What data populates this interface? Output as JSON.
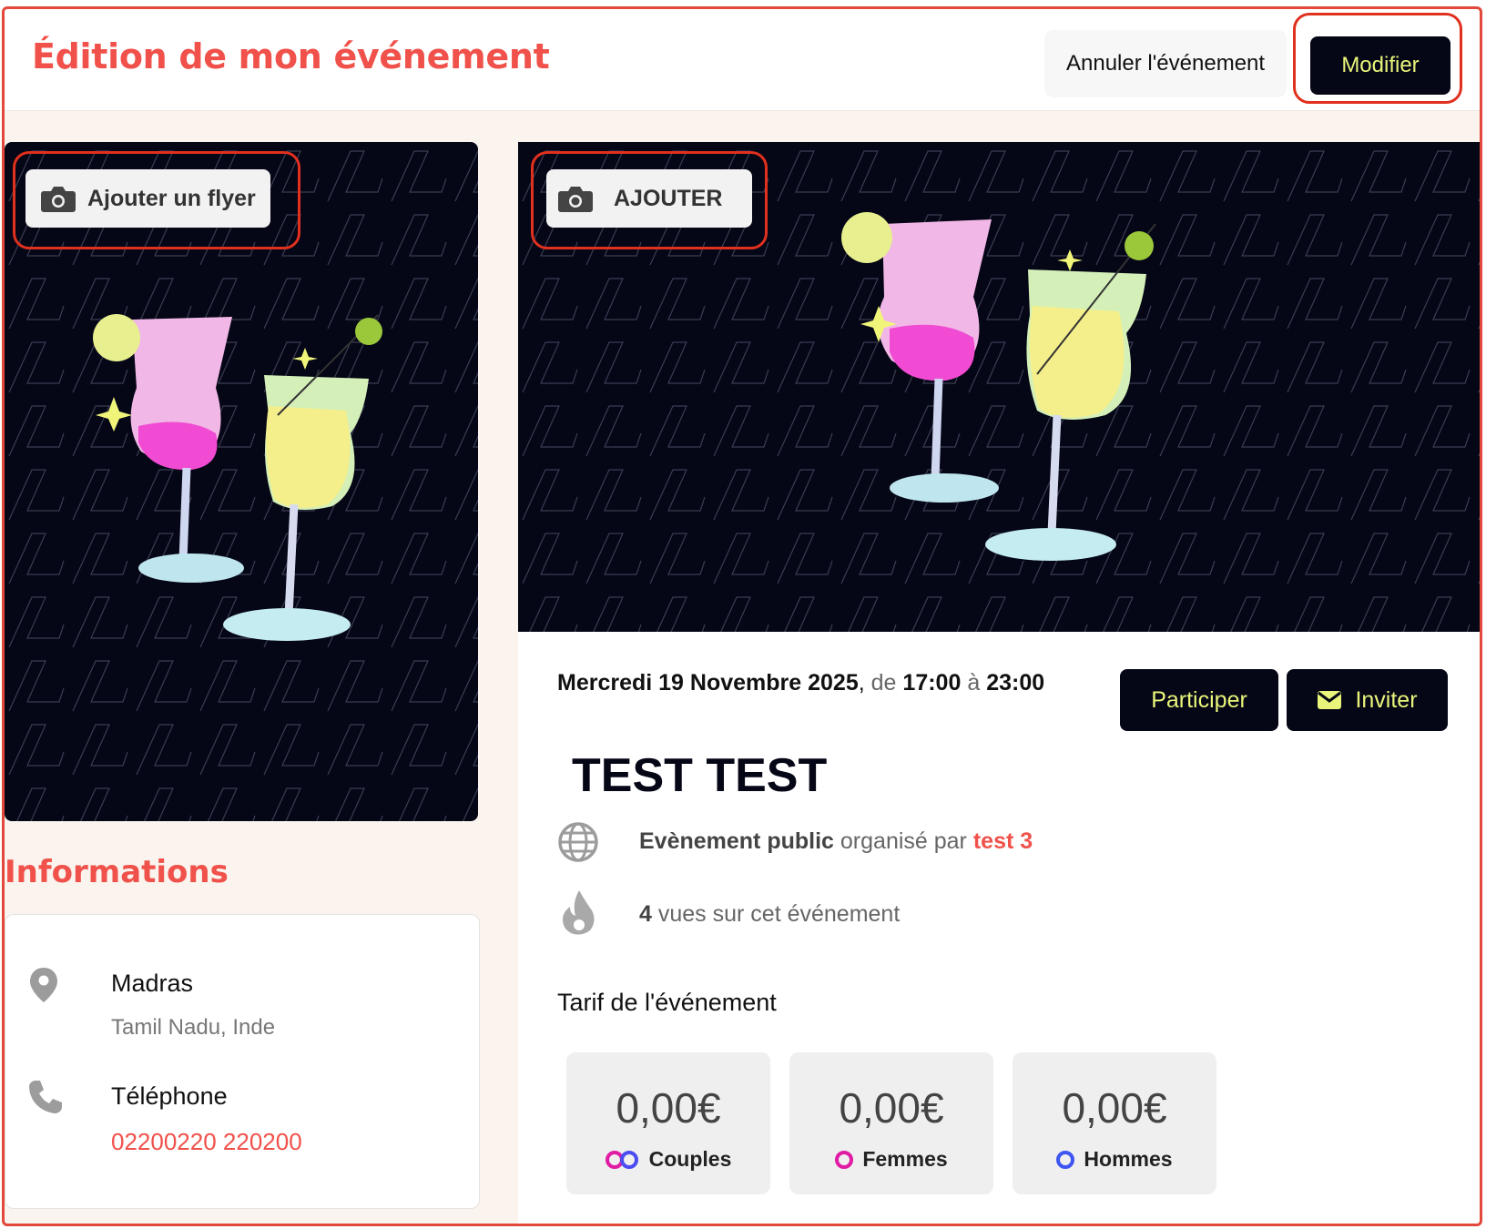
{
  "header": {
    "title": "Édition de mon événement",
    "cancel_label": "Annuler l'événement",
    "modify_label": "Modifier"
  },
  "flyer": {
    "add_label": "Ajouter un flyer",
    "camera_icon": "camera-icon"
  },
  "banner": {
    "add_label": "AJOUTER",
    "camera_icon": "camera-icon"
  },
  "info": {
    "title": "Informations",
    "city": "Madras",
    "region": "Tamil Nadu, Inde",
    "phone_label": "Téléphone",
    "phone_value": "02200220 220200"
  },
  "event": {
    "date": "Mercredi 19 Novembre 2025",
    "date_sep": ",",
    "from_word": "de",
    "start_time": "17:00",
    "to_word": "à",
    "end_time": "23:00",
    "participate_label": "Participer",
    "invite_label": "Inviter",
    "title": "TEST TEST",
    "visibility": "Evènement public",
    "organized_by": "organisé par",
    "organizer": "test 3",
    "views_count": "4",
    "views_text": "vues sur cet événement",
    "tarif_title": "Tarif de l'événement"
  },
  "prices": [
    {
      "value": "0,00€",
      "label": "Couples",
      "color": "#e01ca4",
      "color2": "#4a4cf0"
    },
    {
      "value": "0,00€",
      "label": "Femmes",
      "color": "#e01ca4"
    },
    {
      "value": "0,00€",
      "label": "Hommes",
      "color": "#3f55f2"
    }
  ],
  "colors": {
    "accent": "#f0514a",
    "dark": "#050616",
    "button_text": "#e9f57a",
    "highlight": "#e0301e"
  }
}
